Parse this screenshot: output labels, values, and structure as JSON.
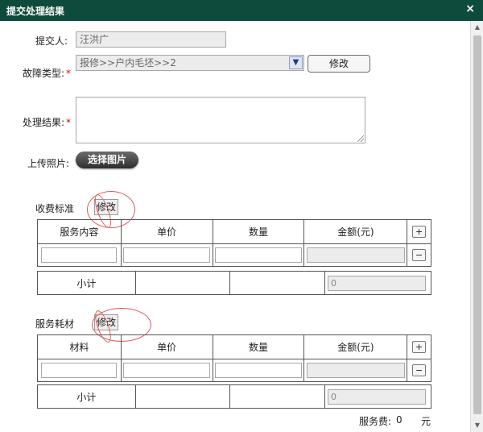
{
  "dialog": {
    "title": "提交处理结果",
    "close_glyph": "×"
  },
  "form": {
    "submitter_label": "提交人:",
    "submitter_value": "汪洪广",
    "fault_type_label": "故障类型:",
    "fault_type_value": "报修>>户内毛坯>>2",
    "required_mark": "*",
    "modify_button": "修改",
    "result_label": "处理结果:",
    "upload_label": "上传照片:",
    "choose_image_button": "选择图片"
  },
  "fee_standard": {
    "title": "收费标准",
    "modify": "修改",
    "columns": [
      "服务内容",
      "单价",
      "数量",
      "金额(元)"
    ],
    "add": "+",
    "remove": "−",
    "subtotal_label": "小计",
    "subtotal_value": "0"
  },
  "materials": {
    "title": "服务耗材",
    "modify": "修改",
    "columns": [
      "材料",
      "单价",
      "数量",
      "金额(元)"
    ],
    "add": "+",
    "remove": "−",
    "subtotal_label": "小计",
    "subtotal_value": "0"
  },
  "service_fee": {
    "label": "服务费:",
    "value": "0",
    "unit": "元"
  },
  "scrollbar": {
    "up": "▲",
    "down": "▼"
  }
}
